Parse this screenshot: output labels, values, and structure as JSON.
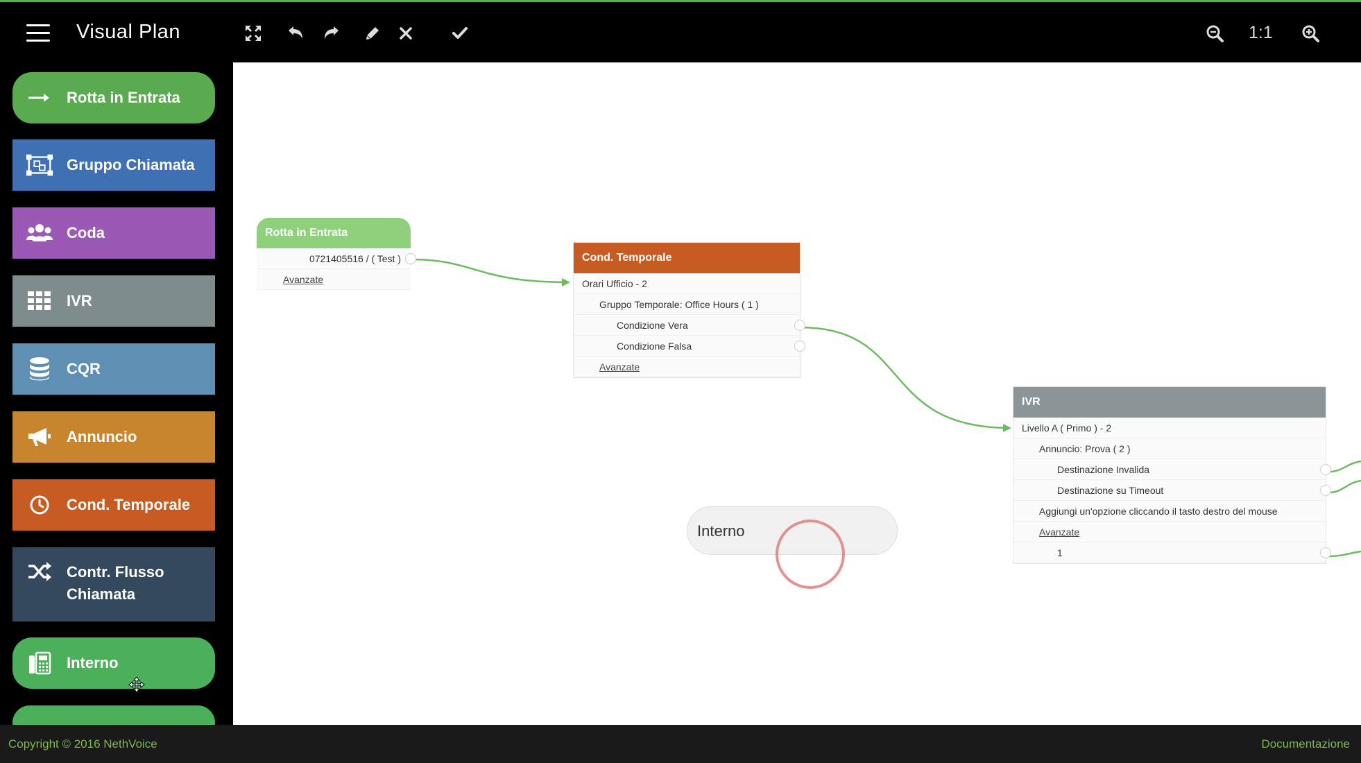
{
  "app": {
    "title": "Visual Plan",
    "zoom_label": "1:1"
  },
  "toolbar": {
    "icons": [
      "fullscreen-icon",
      "undo-icon",
      "redo-icon",
      "edit-icon",
      "delete-icon",
      "confirm-icon"
    ],
    "zoom_out_icon": "zoom-out-icon",
    "zoom_in_icon": "zoom-in-icon"
  },
  "sidebar": {
    "items": [
      {
        "label": "Rotta in Entrata",
        "icon": "arrow-right-icon",
        "color": "#5aab4f"
      },
      {
        "label": "Gruppo Chiamata",
        "icon": "group-icon",
        "color": "#3e70b3"
      },
      {
        "label": "Coda",
        "icon": "users-icon",
        "color": "#9b59b6"
      },
      {
        "label": "IVR",
        "icon": "grid-icon",
        "color": "#7f8c8d"
      },
      {
        "label": "CQR",
        "icon": "database-icon",
        "color": "#5f8fb3"
      },
      {
        "label": "Annuncio",
        "icon": "megaphone-icon",
        "color": "#c7862e"
      },
      {
        "label": "Cond. Temporale",
        "icon": "clock-icon",
        "color": "#c65c22"
      },
      {
        "label": "Contr. Flusso Chiamata",
        "label_line1": "Contr. Flusso",
        "label_line2": "Chiamata",
        "icon": "shuffle-icon",
        "color": "#34495e"
      },
      {
        "label": "Interno",
        "icon": "phone-icon",
        "color": "#4caf5a"
      }
    ]
  },
  "canvas": {
    "nodes": {
      "rotta": {
        "header": "Rotta in Entrata",
        "color": "#8fd07c",
        "rows": [
          "0721405516 / ( Test )",
          "Avanzate"
        ]
      },
      "cond": {
        "header": "Cond. Temporale",
        "color": "#c65c22",
        "rows": [
          "Orari Ufficio - 2",
          "Gruppo Temporale: Office Hours ( 1 )",
          "Condizione Vera",
          "Condizione Falsa",
          "Avanzate"
        ]
      },
      "ivr": {
        "header": "IVR",
        "color": "#8b9598",
        "rows": [
          "Livello A ( Primo ) - 2",
          "Annuncio: Prova ( 2 )",
          "Destinazione Invalida",
          "Destinazione su Timeout",
          "Aggiungi un'opzione cliccando il tasto destro del mouse",
          "Avanzate",
          "1"
        ]
      }
    },
    "drag_item": "Interno"
  },
  "footer": {
    "copyright": "Copyright © 2016 NethVoice",
    "docs": "Documentazione"
  }
}
